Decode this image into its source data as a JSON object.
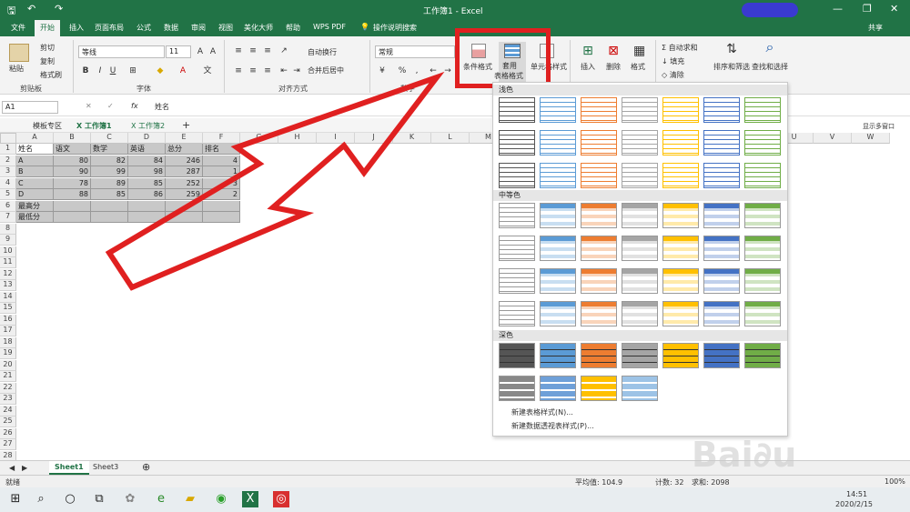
{
  "title": "工作簿1 - Excel",
  "menu": [
    "文件",
    "开始",
    "插入",
    "页面布局",
    "公式",
    "数据",
    "审阅",
    "视图",
    "美化大师",
    "帮助",
    "WPS PDF",
    "操作说明搜索"
  ],
  "share": "共享",
  "ribbon": {
    "paste": "粘贴",
    "cut": "剪切",
    "copy": "复制",
    "format_painter": "格式刷",
    "clipboard": "剪贴板",
    "font_name": "等线",
    "font_size": "11",
    "font_group": "字体",
    "wrap": "自动换行",
    "merge": "合并后居中",
    "align_group": "对齐方式",
    "number_format": "常规",
    "number_group": "数字",
    "cond_format": "条件格式",
    "table_format": "套用\n表格格式",
    "cell_style": "单元格样式",
    "insert": "插入",
    "delete": "删除",
    "format": "格式",
    "autosum": "自动求和",
    "fill": "填充",
    "clear": "清除",
    "sort": "排序和筛选",
    "find": "查找和选择"
  },
  "formula": {
    "name_box": "A1",
    "fx": "fx",
    "value": "姓名"
  },
  "filetabs": [
    "模板专区",
    "工作簿1",
    "工作簿2"
  ],
  "show_multi": "显示多窗口",
  "columns": [
    "A",
    "B",
    "C",
    "D",
    "E",
    "F",
    "G",
    "H",
    "I",
    "J",
    "K",
    "L",
    "M",
    "N",
    "O",
    "P",
    "Q",
    "R",
    "S",
    "T",
    "U",
    "V",
    "W"
  ],
  "rows": [
    "1",
    "2",
    "3",
    "4",
    "5",
    "6",
    "7",
    "8",
    "9",
    "10",
    "11",
    "12",
    "13",
    "14",
    "15",
    "16",
    "17",
    "18",
    "19",
    "20",
    "21",
    "22",
    "23",
    "24",
    "25",
    "26",
    "27",
    "28"
  ],
  "table": [
    [
      "姓名",
      "语文",
      "数学",
      "英语",
      "总分",
      "排名"
    ],
    [
      "A",
      "80",
      "82",
      "84",
      "246",
      "4"
    ],
    [
      "B",
      "90",
      "99",
      "98",
      "287",
      "1"
    ],
    [
      "C",
      "78",
      "89",
      "85",
      "252",
      "3"
    ],
    [
      "D",
      "88",
      "85",
      "86",
      "259",
      "2"
    ],
    [
      "最高分",
      "",
      "",
      "",
      "",
      ""
    ],
    [
      "最低分",
      "",
      "",
      "",
      "",
      ""
    ]
  ],
  "gallery": {
    "light": "浅色",
    "medium": "中等色",
    "dark": "深色",
    "new_table_style": "新建表格样式(N)...",
    "new_pivot_style": "新建数据透视表样式(P)..."
  },
  "sheets": [
    "Sheet1",
    "Sheet3"
  ],
  "status": {
    "ready": "就绪",
    "avg": "平均值: 104.9",
    "count": "计数: 32",
    "sum": "求和: 2098",
    "zoom": "100%"
  },
  "clock": {
    "time": "14:51",
    "date": "2020/2/15"
  },
  "colors": {
    "accent": "#217346",
    "arrow": "#e02020"
  }
}
